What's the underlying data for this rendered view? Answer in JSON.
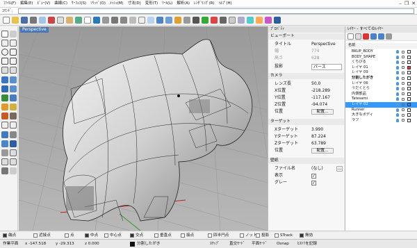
{
  "menu": [
    "ﾌｧｲﾙ(F)",
    "編集(E)",
    "ﾋﾞｭｰ(V)",
    "曲線(C)",
    "ｻｰﾌｪｽ(S)",
    "ｿﾘｯﾄﾞ(O)",
    "ﾒｯｼｭ(M)",
    "寸法(D)",
    "変形(T)",
    "ﾂｰﾙ(L)",
    "解析(A)",
    "ﾚﾝﾀﾞﾘﾝｸﾞ(R)",
    "ﾍﾙﾌﾟ(H)"
  ],
  "command": {
    "label": "ｺﾏﾝﾄﾞ:"
  },
  "viewport": {
    "title": "Perspective"
  },
  "properties": {
    "header": "ﾌﾟﾛﾊﾟﾃｨ",
    "viewport_section": "ビューポート",
    "title_label": "タイトル",
    "title_value": "Perspective",
    "width_label": "幅",
    "width_value": "774",
    "height_label": "高さ",
    "height_value": "628",
    "projection_label": "投影",
    "projection_value": "パース",
    "camera_section": "カメラ",
    "lens_label": "レンズ長",
    "lens_value": "50.0",
    "xpos_label": "X位置",
    "xpos_value": "-218.289",
    "ypos_label": "Y位置",
    "ypos_value": "-117.167",
    "zpos_label": "Z位置",
    "zpos_value": "-94.074",
    "position_label": "位置",
    "place_button": "配置...",
    "target_section": "ターゲット",
    "xtarget_label": "Xターゲット",
    "xtarget_value": "3.990",
    "ytarget_label": "Yターゲット",
    "ytarget_value": "87.224",
    "ztarget_label": "Zターゲット",
    "ztarget_value": "63.789",
    "wallpaper_section": "壁紙",
    "filename_label": "ファイル名",
    "filename_value": "(なし)",
    "show_label": "表示",
    "gray_label": "グレー"
  },
  "layers": {
    "header": "ﾚｲﾔｰ - すべてのﾚｲﾔｰ",
    "name_column": "名前",
    "items": [
      {
        "name": "BKUP_BODY",
        "color": "#ffffff"
      },
      {
        "name": "BODY_SHAPE",
        "color": "#ffffff"
      },
      {
        "name": "くちびる",
        "color": "#ffffff"
      },
      {
        "name": "レイヤ 01",
        "color": "#ff3030"
      },
      {
        "name": "レイヤ 09",
        "color": "#ffffff"
      },
      {
        "name": "分割したがき",
        "color": "#ffffff"
      },
      {
        "name": "レイヤ 06",
        "color": "#ffffff"
      },
      {
        "name": "うだくとら",
        "color": "#ffffff"
      },
      {
        "name": "内側部品",
        "color": "#ffffff"
      },
      {
        "name": "Tatesami",
        "color": "#ffffff"
      },
      {
        "name": "レイヤ 02",
        "color": "#1e90ff"
      },
      {
        "name": "Runner",
        "color": "#ffffff"
      },
      {
        "name": "大きなボディ",
        "color": "#ffffff"
      },
      {
        "name": "ラフ",
        "color": "#ffffff"
      }
    ],
    "selected_index": 10,
    "current_index": 5
  },
  "osnap": [
    {
      "label": "端点",
      "on": true
    },
    {
      "label": "近接点",
      "on": false
    },
    {
      "label": "点",
      "on": false
    },
    {
      "label": "中点",
      "on": true
    },
    {
      "label": "中心点",
      "on": false
    },
    {
      "label": "交点",
      "on": true
    },
    {
      "label": "垂直点",
      "on": false
    },
    {
      "label": "接点",
      "on": false
    },
    {
      "label": "四半円点",
      "on": false
    },
    {
      "label": "ノット",
      "on": false
    },
    {
      "label": "投影",
      "on": false
    },
    {
      "label": "STrack",
      "on": false
    },
    {
      "label": "無効",
      "on": true
    }
  ],
  "status": {
    "cplane": "作業平面",
    "x": "x -147.518",
    "y": "y -29.313",
    "z": "z 0.000",
    "layer": "分割したがき",
    "snap": "ｽﾅｯﾌﾟ",
    "ortho": "直交ﾓｰﾄﾞ",
    "planar": "平面ﾓｰﾄﾞ",
    "osnap": "Osnap",
    "history": "ﾋｽﾄﾘを記録"
  }
}
